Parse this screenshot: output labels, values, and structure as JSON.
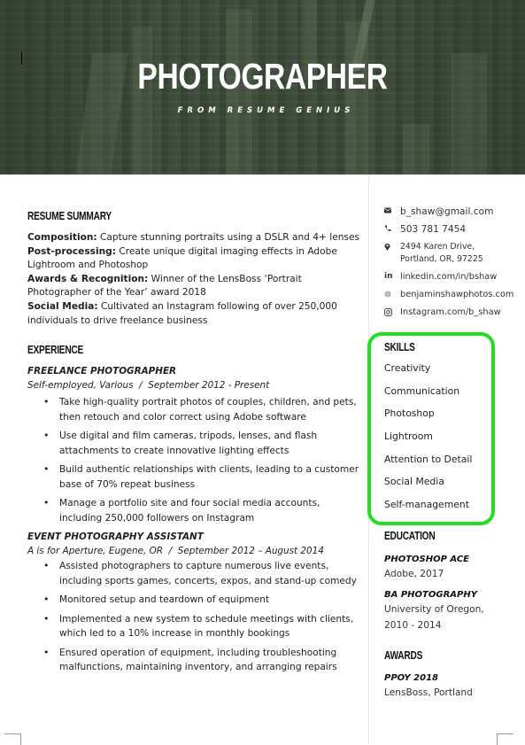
{
  "banner": {
    "title": "PHOTOGRAPHER",
    "subtitle": "FROM RESUME GENIUS",
    "background_color": "#3b4a38"
  },
  "summary": {
    "heading": "RESUME SUMMARY",
    "items": [
      {
        "label": "Composition:",
        "text": " Capture stunning portraits using a DSLR and 4+ lenses"
      },
      {
        "label": "Post-processing:",
        "text": " Create unique digital imaging effects in Adobe Lightroom and Photoshop"
      },
      {
        "label": "Awards & Recognition:",
        "text": " Winner of the LensBoss ‘Portrait Photographer of the Year’ award 2018"
      },
      {
        "label": "Social Media:",
        "text": " Cultivated an Instagram following of over 250,000 individuals to drive freelance business"
      }
    ]
  },
  "experience": {
    "heading": "EXPERIENCE",
    "jobs": [
      {
        "title": "FREELANCE PHOTOGRAPHER",
        "meta": "Self-employed, Various  /  September 2012 - Present",
        "bullets": [
          "Take high-quality portrait photos of couples, children, and pets, then retouch and color correct using Adobe software",
          "Use digital and film cameras, tripods, lenses, and flash attachments to create innovative lighting effects",
          "Build authentic relationships with clients, leading to a customer base of 70% repeat business",
          "Manage a portfolio site and four social media accounts, including 250,000 followers on Instagram"
        ]
      },
      {
        "title": "EVENT PHOTOGRAPHY ASSISTANT",
        "meta": "A is for Aperture, Eugene, OR  /  September 2012 – August 2014",
        "bullets": [
          "Assisted photographers to capture numerous live events, including sports games, concerts, expos, and stand-up comedy",
          "Monitored setup and teardown of equipment",
          "Implemented a new system to schedule meetings with clients, which led to a 10% increase in monthly bookings",
          "Ensured operation of equipment, including troubleshooting malfunctions, maintaining inventory, and arranging repairs"
        ]
      }
    ]
  },
  "contact": {
    "email": {
      "icon": "envelope-icon",
      "text": "b_shaw@gmail.com"
    },
    "phone": {
      "icon": "phone-icon",
      "text": "503 781 7454"
    },
    "address": {
      "icon": "map-pin-icon",
      "line1": "2494 Karen Drive,",
      "line2": "Portland, OR, 97225"
    },
    "linkedin": {
      "icon": "linkedin-icon",
      "text": "linkedin.com/in/bshaw"
    },
    "website": {
      "icon": "globe-icon",
      "text": "benjaminshawphotos.com"
    },
    "instagram": {
      "icon": "instagram-icon",
      "text": "Instagram.com/b_shaw"
    }
  },
  "skills": {
    "heading": "SKILLS",
    "highlight_color": "#22dd22",
    "items": [
      "Creativity",
      "Communication",
      "Photoshop",
      "Lightroom",
      "Attention to Detail",
      "Social Media",
      "Self-management"
    ]
  },
  "education": {
    "heading": "EDUCATION",
    "items": [
      {
        "title": "PHOTOSHOP ACE",
        "lines": [
          "Adobe, 2017"
        ]
      },
      {
        "title": "BA PHOTOGRAPHY",
        "lines": [
          "University of Oregon,",
          "2010 - 2014"
        ]
      }
    ]
  },
  "awards": {
    "heading": "AWARDS",
    "items": [
      {
        "title": "PPOY 2018",
        "lines": [
          "LensBoss, Portland"
        ]
      }
    ]
  }
}
